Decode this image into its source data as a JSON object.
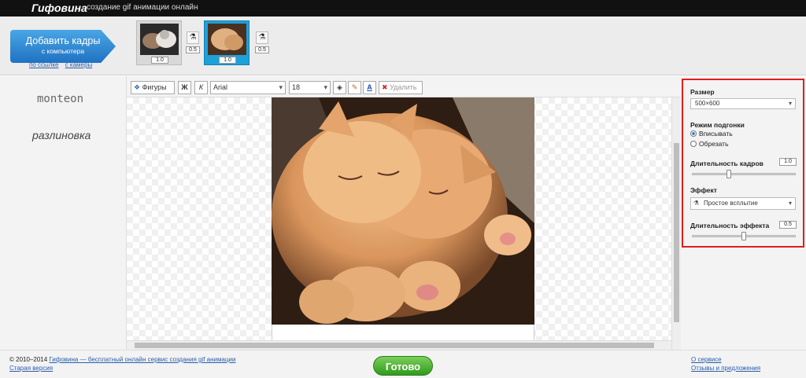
{
  "header": {
    "logo": "Гифовина",
    "tagline": "создание gif анимации онлайн"
  },
  "frames_bar": {
    "add_button_title": "Добавить кадры",
    "add_button_sub": "с компьютера",
    "link_url": "по ссылке",
    "link_camera": "с камеры",
    "frames": [
      {
        "duration": "1.0",
        "selected": false,
        "effect_duration": "0.5"
      },
      {
        "duration": "1.0",
        "selected": true,
        "effect_duration": "0.5"
      }
    ]
  },
  "left_panel": {
    "mode1": "monteon",
    "mode2": "разлиновка"
  },
  "toolbar": {
    "shapes": "Фигуры",
    "bold": "Ж",
    "italic": "К",
    "font": "Arial",
    "size": "18",
    "delete": "Удалить"
  },
  "settings": {
    "size_label": "Размер",
    "size_value": "500×600",
    "fit_label": "Режим подгонки",
    "fit_option1": "Вписывать",
    "fit_option2": "Обрезать",
    "frame_duration_label": "Длительность кадров",
    "frame_duration_value": "1.0",
    "frame_duration_level": 0.35,
    "effect_label": "Эффект",
    "effect_value": "Простое всплытие",
    "effect_duration_label": "Длительность эффекта",
    "effect_duration_value": "0.5",
    "effect_duration_level": 0.5
  },
  "footer": {
    "copyright_prefix": "© 2010–2014",
    "copyright_link": "Гифовина — бесплатный онлайн сервис создания gif анимации",
    "old_version": "Старая версия",
    "done_button": "Готово",
    "about": "О сервисе",
    "feedback": "Отзывы и предложения"
  },
  "colors": {
    "accent_blue": "#1f72c2",
    "selected_frame": "#1ea0d8",
    "done_green": "#2f9a1d",
    "highlight_red": "#e31c1c"
  }
}
